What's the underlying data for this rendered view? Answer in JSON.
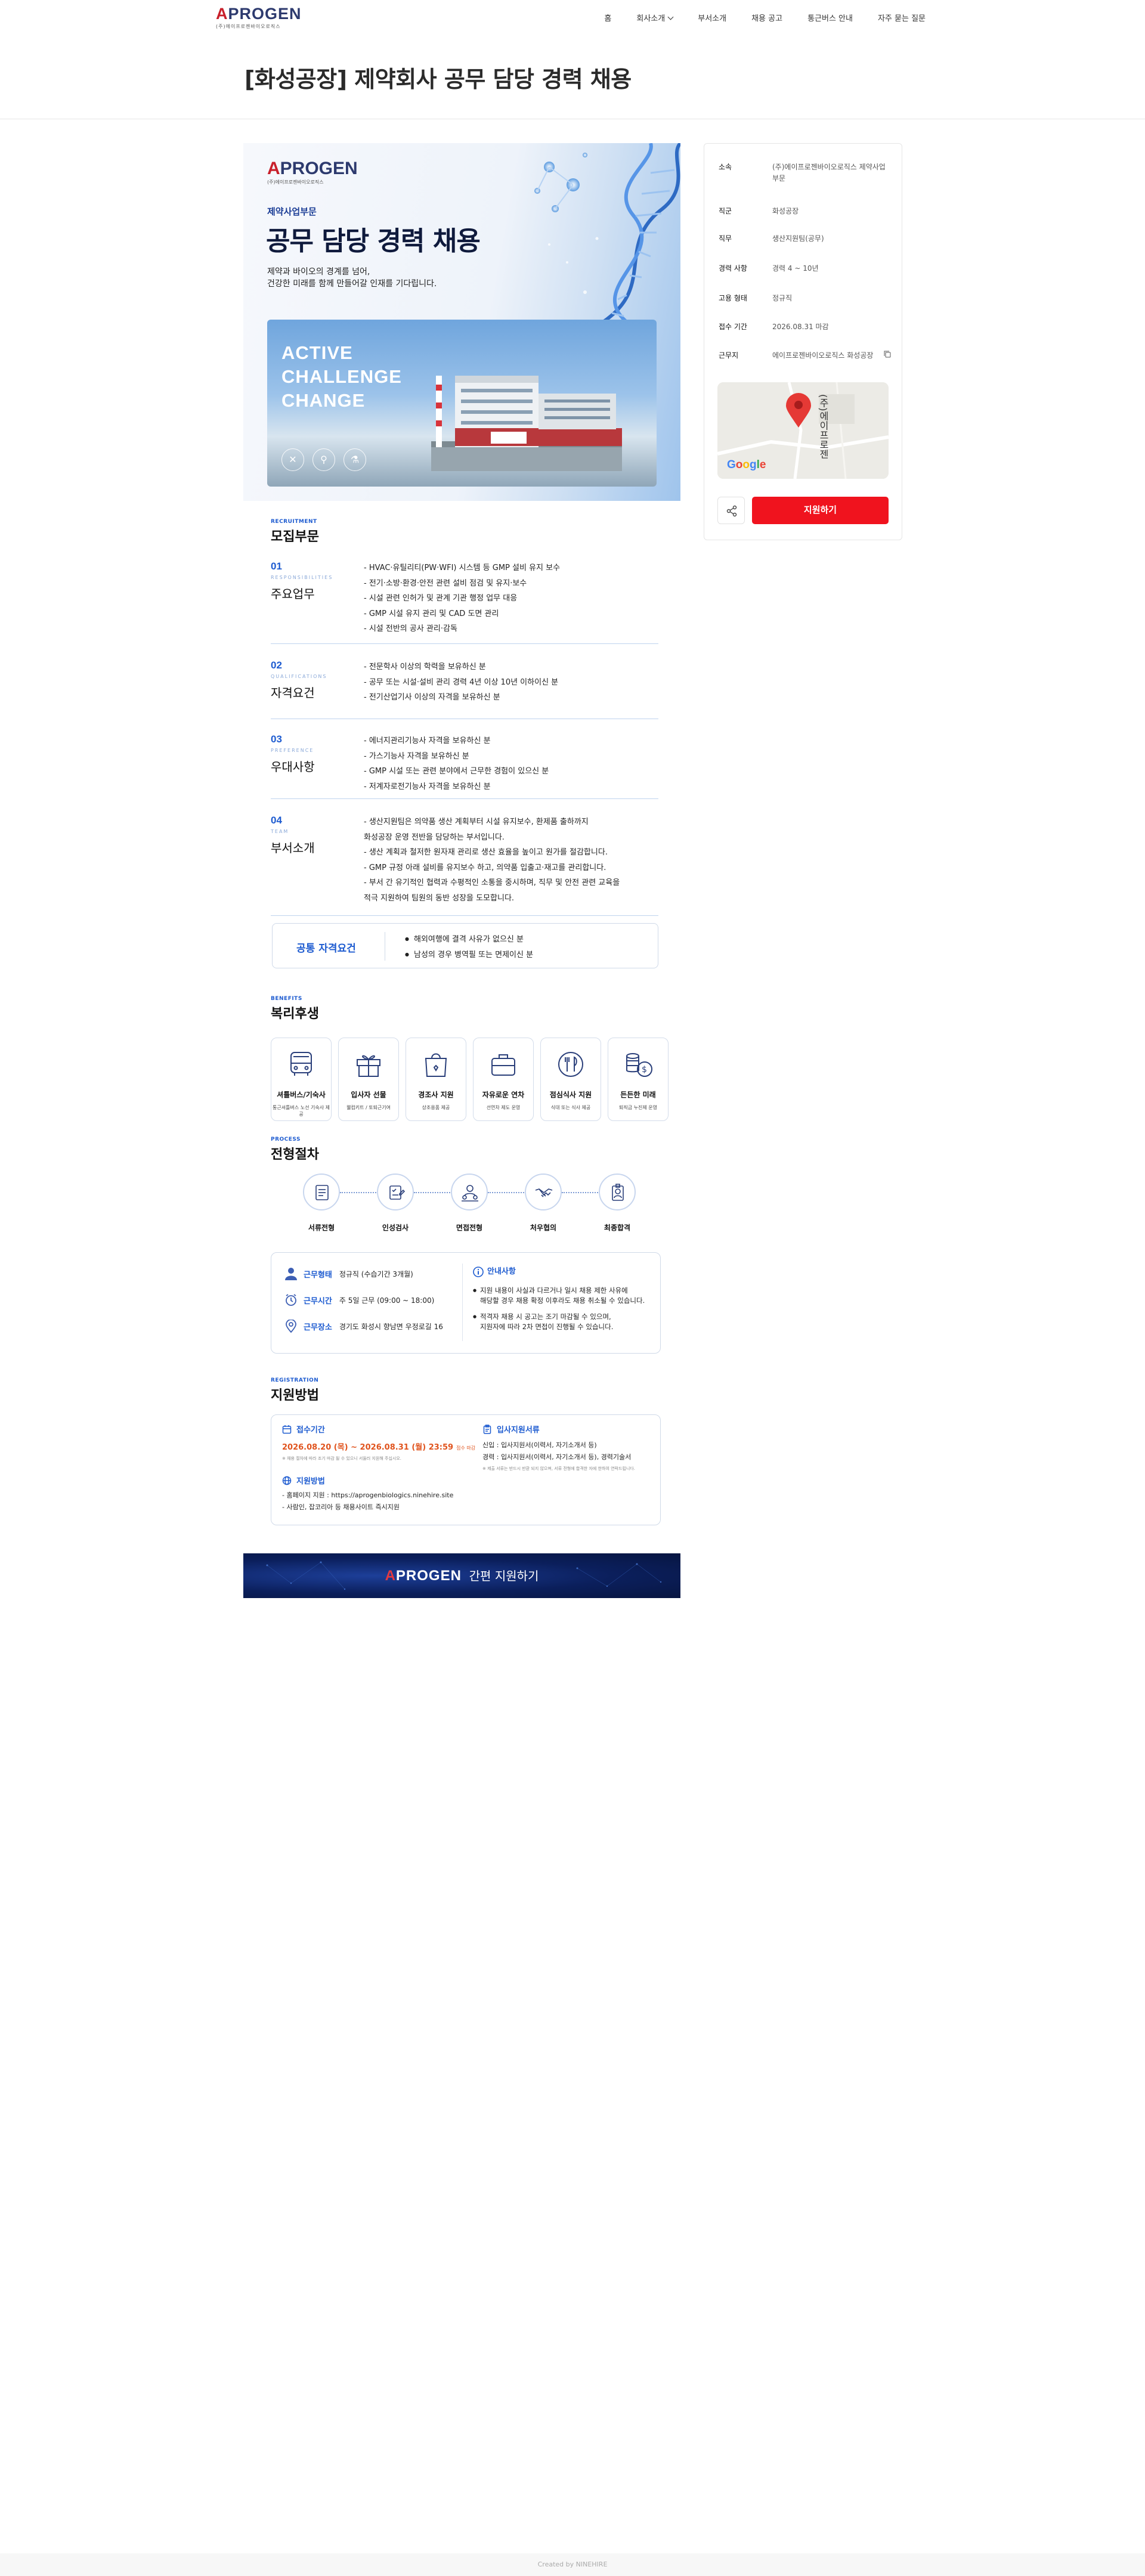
{
  "header": {
    "logo_brand": "APROGEN",
    "logo_sub": "(주)에이프로젠바이오로직스",
    "nav": [
      "홈",
      "회사소개",
      "부서소개",
      "채용 공고",
      "통근버스 안내",
      "자주 묻는 질문"
    ]
  },
  "page_title": "[화성공장] 제약회사 공무 담당 경력 채용",
  "hero": {
    "dept": "제약사업부문",
    "headline": "공무 담당 경력 채용",
    "desc1": "제약과 바이오의 경계를 넘어,",
    "desc2": "건강한 미래를 함께 만들어갈 인재를 기다립니다.",
    "slogan": [
      "ACTIVE",
      "CHALLENGE",
      "CHANGE"
    ]
  },
  "recruit": {
    "tag": "RECRUITMENT",
    "title": "모집부문",
    "blocks": [
      {
        "num": "01",
        "en": "RESPONSIBILITIES",
        "ko": "주요업무",
        "items": [
          "- HVAC·유틸리티(PW·WFI) 시스템 등 GMP 설비 유지 보수",
          "- 전기·소방·환경·안전 관련 설비 점검 및 유지·보수",
          "- 시설 관련 인허가 및 관계 기관 행정 업무 대응",
          "- GMP 시설 유지 관리 및 CAD 도면 관리",
          "- 시설 전반의 공사 관리·감독"
        ]
      },
      {
        "num": "02",
        "en": "QUALIFICATIONS",
        "ko": "자격요건",
        "items": [
          "- 전문학사 이상의 학력을 보유하신 분",
          "- 공무 또는 시설·설비 관리 경력 4년 이상 10년 이하이신 분",
          "- 전기산업기사 이상의 자격을 보유하신 분"
        ]
      },
      {
        "num": "03",
        "en": "PREFERENCE",
        "ko": "우대사항",
        "items": [
          "- 에너지관리기능사 자격을 보유하신 분",
          "- 가스기능사 자격을 보유하신 분",
          "- GMP 시설 또는 관련 분야에서 근무한 경험이 있으신 분",
          "- 저계자로전기능사 자격을 보유하신 분"
        ]
      },
      {
        "num": "04",
        "en": "TEAM",
        "ko": "부서소개",
        "items": [
          "- 생산지원팀은 의약품 생산 계획부터 시설 유지보수, 환제품 출하까지",
          "   화성공장 운영 전반을 담당하는 부서입니다.",
          "- 생산 계획과 철저한 원자재 관리로 생산 효율을 높이고 원가를 절감합니다.",
          "- GMP 규정 아래 설비를 유지보수 하고, 의약품 입출고·재고를 관리합니다.",
          "- 부서 간 유기적인 협력과 수평적인 소통을 중시하며, 직무 및 안전 관련 교육을",
          "   적극 지원하여 팀원의 동반 성장을 도모합니다."
        ]
      }
    ]
  },
  "common": {
    "label": "공통 자격요건",
    "items": [
      "해외여행에 결격 사유가 없으신 분",
      "남성의 경우 병역필 또는 면제이신 분"
    ]
  },
  "welfare": {
    "tag": "BENEFITS",
    "title": "복리후생",
    "cards": [
      {
        "icon": "bus-icon",
        "title": "셔틀버스/기숙사",
        "sub": "통근셔틀버스 노선 기숙사 제공"
      },
      {
        "icon": "gift-icon",
        "title": "입사자 선물",
        "sub": "웰컴키트 / 토퇴근기여"
      },
      {
        "icon": "gift-bag-icon",
        "title": "경조사 지원",
        "sub": "상조용품 제공"
      },
      {
        "icon": "briefcase-icon",
        "title": "자유로운 연차",
        "sub": "선연차 제도 운영"
      },
      {
        "icon": "meal-icon",
        "title": "점심식사 지원",
        "sub": "식대 또는 식사 제공"
      },
      {
        "icon": "money-icon",
        "title": "든든한 미래",
        "sub": "퇴직금 누진제 운영"
      }
    ]
  },
  "process": {
    "tag": "PROCESS",
    "title": "전형절차",
    "steps": [
      "서류전형",
      "인성검사",
      "면접전형",
      "처우협의",
      "최종합격"
    ]
  },
  "conditions": {
    "rows": [
      {
        "key": "근무형태",
        "value": "정규직 (수습기간 3개월)"
      },
      {
        "key": "근무시간",
        "value": "주 5일 근무 (09:00 ~ 18:00)"
      },
      {
        "key": "근무장소",
        "value": "경기도 화성시 향남면 우정로길 16"
      }
    ],
    "notice_title": "안내사항",
    "notices": [
      "지원 내용이 사실과 다르거나 일시 채용 제한 사유에\n해당할 경우 채용 확정 이후라도 채용 취소될 수 있습니다.",
      "적격자 채용 시 공고는 조기 마감될 수 있으며,\n지원자에 따라 2차 면접이 진행될 수 있습니다."
    ]
  },
  "apply": {
    "tag": "REGISTRATION",
    "title": "지원방법",
    "period_label": "접수기간",
    "period": "2026.08.20 (목) ~ 2026.08.31 (월) 23:59",
    "period_note": "접수 마감",
    "period_tiny": "※ 채용 절차에 따라 조기 마감 될 수 있으니 서둘러 지원해 주십시오.",
    "method_label": "지원방법",
    "method1": "- 홈페이지 지원 : https://aprogenbiologics.ninehire.site",
    "method2": "- 사람인, 잡코리아 등 채용사이트 즉시지원",
    "docs_label": "입사지원서류",
    "docs1": "신입 : 입사지원서(이력서, 자기소개서 등)",
    "docs2": "경력 : 입사지원서(이력서, 자기소개서 등), 경력기술서",
    "docs_tiny": "※ 제출 서류는 반드시 반환 되지 않으며, 서류 전형에 합격한 자에 한하여 연락드립니다."
  },
  "banner": {
    "brand": "APROGEN",
    "text": "간편 지원하기"
  },
  "sidebar": {
    "rows": [
      {
        "k": "소속",
        "v": "(주)에이프로젠바이오로직스 제약사업부문"
      },
      {
        "k": "직군",
        "v": "화성공장"
      },
      {
        "k": "직무",
        "v": "생산지원팀(공무)"
      },
      {
        "k": "경력 사항",
        "v": "경력 4 ~ 10년"
      },
      {
        "k": "고용 형태",
        "v": "정규직"
      },
      {
        "k": "접수 기간",
        "v": "2026.08.31 마감"
      },
      {
        "k": "근무지",
        "v": "에이프로젠바이오로직스 화성공장"
      }
    ],
    "map_pin_label": "(주)에이프로젠",
    "map_google": "Google",
    "apply_button": "지원하기"
  },
  "footer": "Created by NINEHIRE",
  "colors": {
    "accent": "#1d5bd0",
    "apply": "#f0131e",
    "brand_red": "#c8202b",
    "brand_navy": "#2d3a6e"
  }
}
